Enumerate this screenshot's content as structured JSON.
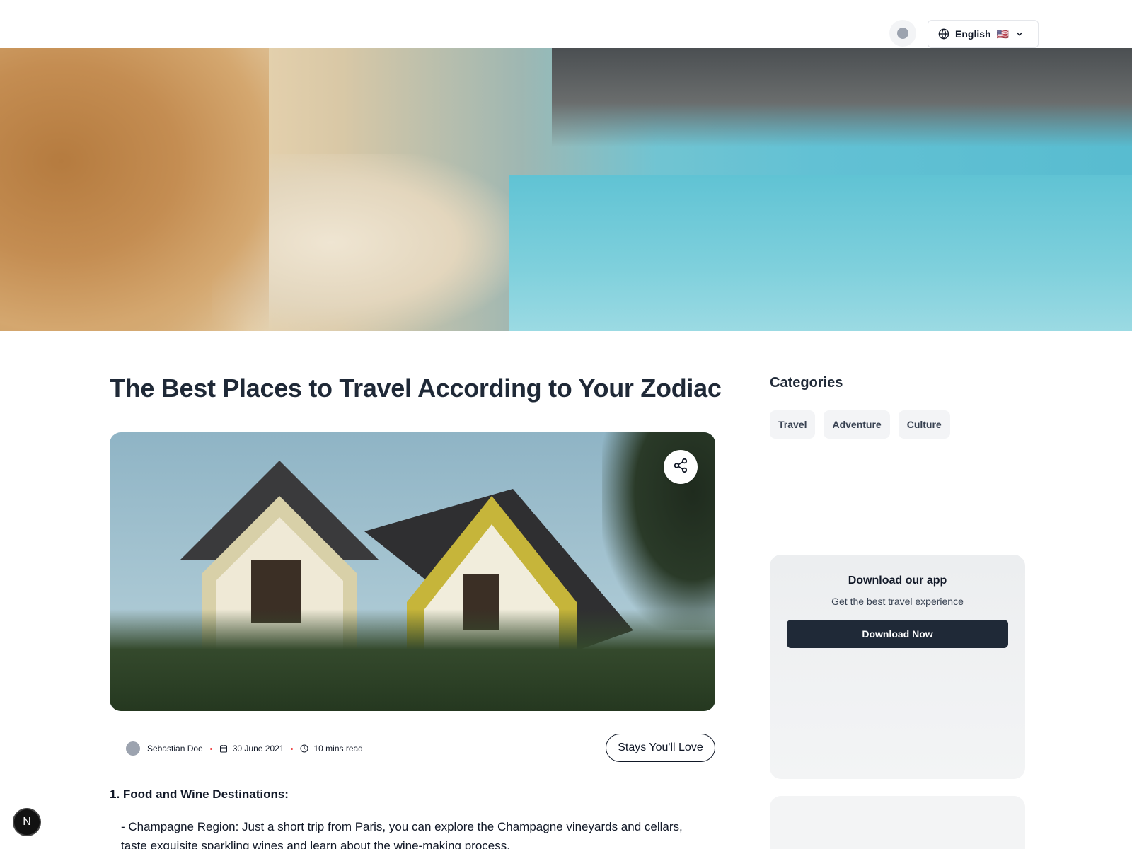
{
  "header": {
    "theme_toggle_label": "",
    "language": {
      "label": "English",
      "flag": "🇺🇸"
    }
  },
  "article": {
    "title": "The Best Places to Travel According to Your Zodiac",
    "author": "Sebastian Doe",
    "date": "30 June 2021",
    "read_time": "10 mins read",
    "tag_button": "Stays You'll Love",
    "section_heading": "1. Food and Wine Destinations:",
    "body_line_1": "- Champagne Region: Just a short trip from Paris, you can explore the Champagne vineyards and cellars,",
    "body_line_2": "taste exquisite sparkling wines and learn about the wine-making process."
  },
  "sidebar": {
    "categories_heading": "Categories",
    "categories": [
      {
        "label": "Travel"
      },
      {
        "label": "Adventure"
      },
      {
        "label": "Culture"
      }
    ],
    "app_card": {
      "title": "Download our app",
      "subtitle": "Get the best travel experience",
      "button": "Download Now"
    }
  },
  "badge": {
    "letter": "N"
  },
  "colors": {
    "primary_button": "#1f2937",
    "chip_bg": "#f3f4f6",
    "meta_separator": "#ef4444"
  }
}
